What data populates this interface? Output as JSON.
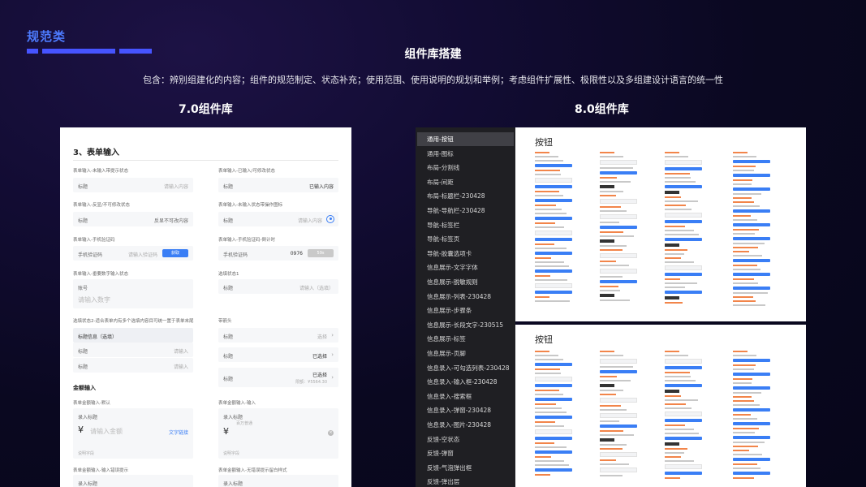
{
  "header": {
    "section_tag": "规范类",
    "title": "组件库搭建",
    "description": "包含：辨别组建化的内容；组件的规范制定、状态补充；使用范围、使用说明的规划和举例；考虑组件扩展性、极限性以及多组建设计语言的统一性",
    "left_subtitle": "7.0组件库",
    "right_subtitle": "8.0组件库",
    "accent_color": "#4d7bff"
  },
  "panel7": {
    "heading": "3、表单输入",
    "items": {
      "c1": "表单输入-未输入带提示状态",
      "c2": "表单输入-已输入/可修改状态",
      "c3": "表单输入-反显/不可修改状态",
      "c4": "表单输入-未输入状态带操作图标",
      "c5": "表单输入-手机验证码",
      "c6": "表单输入-手机验证码-倒计时",
      "c7": "表单输入-垂要数字输入状态",
      "c8": "选填状态1",
      "c9": "选填状态2-适合表单内有多个选填内容目可统一置于表单末尾",
      "c10": "带箭头",
      "c11": "金额输入",
      "c12": "表单金额输入-默认",
      "c13": "表单金额输入-输入",
      "c14": "表单金额输入-输入错误提示",
      "c15": "表单金额输入-无错误提示留白样式"
    },
    "labels": {
      "title": "标题",
      "placeholder": "请输入内容",
      "entered": "已输入内容",
      "readonly": "反显不可改内容",
      "phone_label": "手机验证码",
      "phone_placeholder": "请输入验证码",
      "get_btn": "获取",
      "countdown_value": "0976",
      "countdown_btn": "59s",
      "account": "账号",
      "number_placeholder": "请输入数字",
      "optional_placeholder": "请输入（选填）",
      "group_title": "标题信息（选填）",
      "input": "请输入",
      "select": "选择",
      "selected": "已选择",
      "amount_small": "限额：¥5564.30",
      "enter_title": "录入标题",
      "amount_placeholder": "请输入金额",
      "text_link": "文字链接",
      "yen": "¥",
      "note": "说明字段",
      "upper_amount": "百万普通"
    }
  },
  "panel8": {
    "sidebar_items": [
      "通用-按钮",
      "通用-图标",
      "布局-分割线",
      "布局-间距",
      "布局-标题栏-230428",
      "导航-导航栏-230428",
      "导航-标签栏",
      "导航-标签页",
      "导航-胶囊选项卡",
      "信息展示-文字字体",
      "信息展示-脱敏规则",
      "信息展示-列表-230428",
      "信息展示-步骤条",
      "信息展示-长段文字-230515",
      "信息展示-标签",
      "信息展示-页脚",
      "信息录入-可勾选列表-230428",
      "信息录入-输入框-230428",
      "信息录入-搜索框",
      "信息录入-弹窗-230428",
      "信息录入-图片-230428",
      "反馈-空状态",
      "反馈-弹窗",
      "反馈-气泡弹出框",
      "反馈-弹出层"
    ],
    "active_index": 0,
    "preview_title": "按钮",
    "preview2_title": "按钮"
  }
}
